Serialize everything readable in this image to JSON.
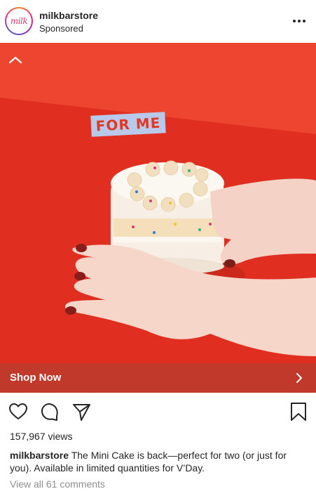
{
  "post": {
    "username": "milkbarstore",
    "subtitle": "Sponsored",
    "avatar_text": "milk",
    "more_icon": "more-dots-icon"
  },
  "media": {
    "sticker_text": "FOR ME",
    "background_color": "#e23826"
  },
  "cta": {
    "label": "Shop Now",
    "color": "#c0392b"
  },
  "actions": {
    "icons": [
      "heart-icon",
      "comment-icon",
      "share-icon",
      "bookmark-icon"
    ]
  },
  "stats": {
    "views": "157,967 views"
  },
  "caption": {
    "username": "milkbarstore",
    "text": "The Mini Cake is back—perfect for two (or just for you). Available in limited quantities for V’Day."
  },
  "comments": {
    "link": "View all 61 comments"
  }
}
